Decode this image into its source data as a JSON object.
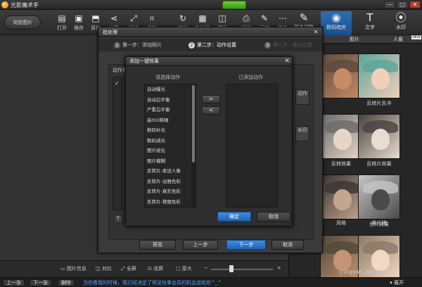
{
  "app": {
    "title": "光影魔术手",
    "window_controls": [
      "—",
      "□",
      "✕"
    ]
  },
  "toolbar": {
    "browse_label": "浏览图片",
    "tools": [
      {
        "label": "打开",
        "icon": "folder-icon",
        "glyph": "▤"
      },
      {
        "label": "保存",
        "icon": "save-icon",
        "glyph": "▣"
      },
      {
        "label": "另存",
        "icon": "save-as-icon",
        "glyph": "⬒"
      },
      {
        "label": "分享",
        "icon": "share-icon",
        "glyph": "⋖"
      },
      {
        "label": "尺寸",
        "icon": "resize-icon",
        "glyph": "⤢"
      },
      {
        "label": "裁剪",
        "icon": "crop-icon",
        "glyph": "⌗"
      },
      {
        "label": "旋转",
        "icon": "rotate-icon",
        "glyph": "↻"
      },
      {
        "label": "批处理",
        "icon": "batch-icon",
        "glyph": "▦"
      },
      {
        "label": "模板",
        "icon": "template-icon",
        "glyph": "◫"
      },
      {
        "label": "打印",
        "icon": "print-icon",
        "glyph": "⎙"
      },
      {
        "label": "画笔",
        "icon": "brush-icon",
        "glyph": "✎"
      },
      {
        "label": "更多",
        "icon": "more-icon",
        "glyph": "⋯"
      }
    ],
    "right_tools": [
      {
        "label": "基本调整",
        "icon": "adjust-icon",
        "glyph": "✎"
      },
      {
        "label": "数码暗房",
        "icon": "camera-icon",
        "glyph": "◉"
      },
      {
        "label": "文字",
        "icon": "text-icon",
        "glyph": "T"
      },
      {
        "label": "水印",
        "icon": "watermark-icon",
        "glyph": "⦿"
      }
    ]
  },
  "right_panel": {
    "tabs": [
      "胶片",
      "人像"
    ],
    "new_badge": "NEW",
    "thumbnails": [
      {
        "label": "",
        "colors": [
          "#5a4a3e",
          "#c88b63"
        ]
      },
      {
        "label": "反转片负冲",
        "colors": [
          "#5aa59a",
          "#f2cfb8"
        ]
      },
      {
        "label": "反转效果",
        "colors": [
          "#6a6a6a",
          "#e6d6c6"
        ]
      },
      {
        "label": "反转片效果",
        "colors": [
          "#4a4240",
          "#e8ddd0"
        ]
      },
      {
        "label": "",
        "colors": [
          "#3a3432",
          "#c3a590"
        ]
      },
      {
        "label": "负片效果",
        "colors": [
          "#c5c5c5",
          "#4a4a4a"
        ]
      },
      {
        "label": "",
        "colors": [
          "#50473a",
          "#c49474"
        ]
      },
      {
        "label": "",
        "colors": [
          "#8a7866",
          "#f2d8c2"
        ]
      },
      {
        "label": "风格",
        "colors": [],
        "rowlabel": true
      },
      {
        "label": "柔光镜",
        "colors": [],
        "rowlabel": true
      }
    ],
    "partial_labels": [
      "动作",
      "长印"
    ]
  },
  "batch_dialog": {
    "title": "批处理",
    "steps": [
      {
        "num": "1",
        "label": "第一步：添加照片"
      },
      {
        "num": "2",
        "label": "第二步：动作设置"
      },
      {
        "num": "3",
        "label": "第三步：输出设置"
      }
    ],
    "left_label": "动作列",
    "side_buttons": [
      "动作",
      "水印"
    ],
    "buttons": {
      "preview": "预览",
      "prev": "上一步",
      "next": "下一步",
      "cancel": "取消"
    }
  },
  "add_effect_dialog": {
    "title": "添加一键效果",
    "left_header": "请选择动作",
    "right_header": "已添加动作",
    "actions": [
      "自动曝光",
      "自动白平衡",
      "严重白平衡",
      "高ISO降噪",
      "数码补光",
      "数码减光",
      "图片锐化",
      "图片模糊",
      "反转片-柔设人像",
      "反转片-淡雅色彩",
      "反转片-真实色彩",
      "反转片-艳丽色彩"
    ],
    "add_arrow": ">",
    "remove_arrow": "<",
    "ok": "确定",
    "cancel": "取消"
  },
  "view_bar": {
    "items": [
      {
        "label": "图片信息",
        "icon": "info-icon"
      },
      {
        "label": "对比",
        "icon": "compare-icon"
      },
      {
        "label": "全屏",
        "icon": "fullscreen-icon"
      },
      {
        "label": "适屏",
        "icon": "fit-icon"
      },
      {
        "label": "原大",
        "icon": "actual-size-icon"
      }
    ]
  },
  "status_bar": {
    "prev": "上一张",
    "next": "下一张",
    "delete": "删除",
    "message": "当你看我的时候，我已经决定了将这份拿会员的机会送给你^_^",
    "expand": "展开"
  },
  "watermark_text": "jingyan.baidu.com"
}
